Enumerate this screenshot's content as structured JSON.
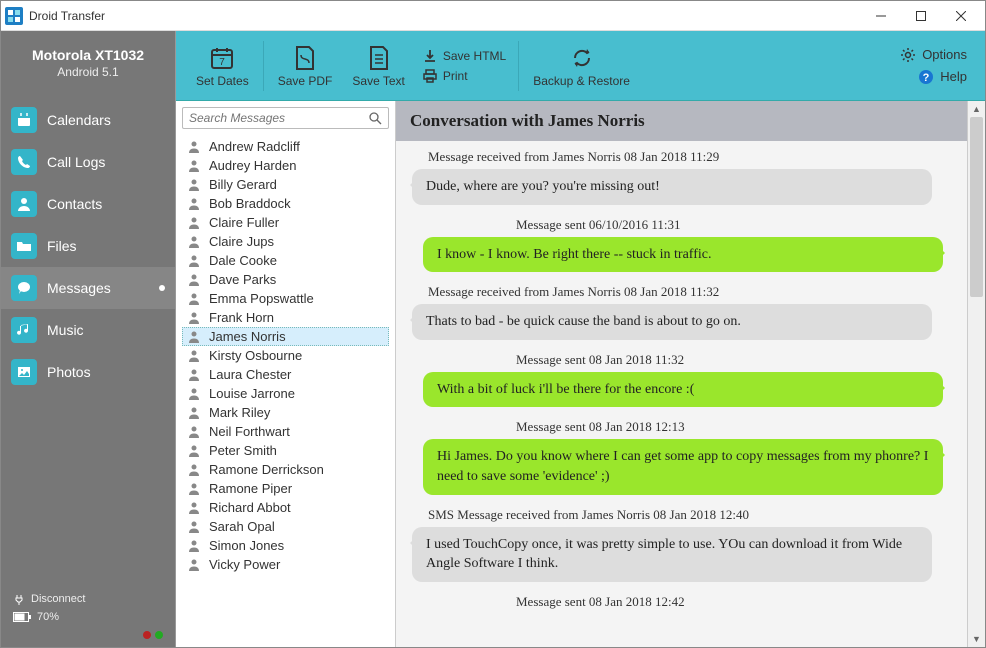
{
  "window": {
    "title": "Droid Transfer"
  },
  "device": {
    "name": "Motorola XT1032",
    "version": "Android 5.1"
  },
  "nav": [
    {
      "id": "calendars",
      "label": "Calendars",
      "icon": "calendar"
    },
    {
      "id": "calllogs",
      "label": "Call Logs",
      "icon": "phone"
    },
    {
      "id": "contacts",
      "label": "Contacts",
      "icon": "contact"
    },
    {
      "id": "files",
      "label": "Files",
      "icon": "folder"
    },
    {
      "id": "messages",
      "label": "Messages",
      "icon": "chat",
      "active": true,
      "dot": true
    },
    {
      "id": "music",
      "label": "Music",
      "icon": "music"
    },
    {
      "id": "photos",
      "label": "Photos",
      "icon": "image"
    }
  ],
  "footer": {
    "disconnect": "Disconnect",
    "battery": "70%"
  },
  "toolbar": {
    "set_dates": "Set Dates",
    "save_pdf": "Save PDF",
    "save_text": "Save Text",
    "save_html": "Save HTML",
    "print": "Print",
    "backup_restore": "Backup & Restore",
    "options": "Options",
    "help": "Help"
  },
  "search": {
    "placeholder": "Search Messages"
  },
  "contacts": [
    "Andrew Radcliff",
    "Audrey Harden",
    "Billy Gerard",
    "Bob Braddock",
    "Claire Fuller",
    "Claire Jups",
    "Dale Cooke",
    "Dave Parks",
    "Emma Popswattle",
    "Frank Horn",
    "James Norris",
    "Kirsty Osbourne",
    "Laura Chester",
    "Louise Jarrone",
    "Mark Riley",
    "Neil Forthwart",
    "Peter Smith",
    "Ramone Derrickson",
    "Ramone Piper",
    "Richard Abbot",
    "Sarah Opal",
    "Simon Jones",
    "Vicky Power"
  ],
  "selected_contact": "James Norris",
  "conversation": {
    "title": "Conversation with James Norris",
    "messages": [
      {
        "dir": "recv",
        "meta": "Message received from James Norris 08 Jan 2018 11:29",
        "text": "Dude, where are you? you're missing out!"
      },
      {
        "dir": "sent",
        "meta": "Message sent 06/10/2016 11:31",
        "text": "I know - I know. Be right there -- stuck in traffic."
      },
      {
        "dir": "recv",
        "meta": "Message received from James Norris 08 Jan 2018 11:32",
        "text": "Thats to bad - be quick cause the band is about to go on."
      },
      {
        "dir": "sent",
        "meta": "Message sent 08 Jan 2018 11:32",
        "text": "With a bit of luck i'll be there for the encore :("
      },
      {
        "dir": "sent",
        "meta": "Message sent 08 Jan 2018 12:13",
        "text": "Hi James. Do you know where I can get some app to copy messages from my phonre? I need to save some 'evidence' ;)"
      },
      {
        "dir": "recv",
        "meta": "SMS Message received from James Norris 08 Jan 2018 12:40",
        "text": "I used TouchCopy once, it was pretty simple to use. YOu can download it from Wide Angle Software I think."
      },
      {
        "dir": "sent",
        "meta": "Message sent 08 Jan 2018 12:42",
        "text": ""
      }
    ]
  }
}
